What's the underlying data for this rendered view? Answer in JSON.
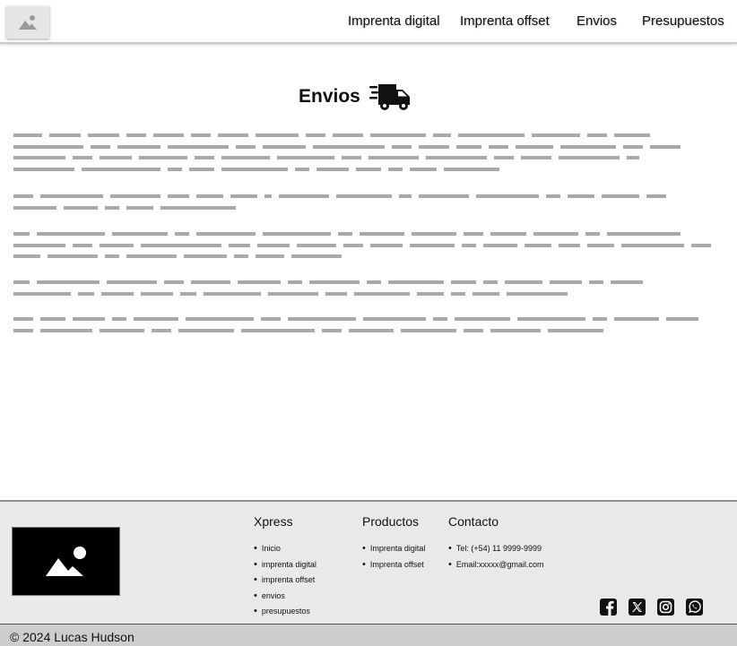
{
  "header": {
    "logo_icon": "image-placeholder-icon",
    "nav": [
      "Imprenta digital",
      "Imprenta offset",
      "Envios",
      "Presupuestos"
    ]
  },
  "main": {
    "title": "Envios",
    "title_icon": "shipping-truck-icon"
  },
  "footer": {
    "image_icon": "image-placeholder-icon",
    "columns": [
      {
        "title": "Xpress",
        "items": [
          "Inicio",
          "imprenta digital",
          "imprenta  offset",
          "envios",
          "presupuestos"
        ]
      },
      {
        "title": "Productos",
        "items": [
          "Imprenta digital",
          "Imprenta offset"
        ]
      },
      {
        "title": "Contacto",
        "items": [
          "Tel: (+54) 11 9999-9999",
          "Email:xxxxx@gmail.com"
        ]
      }
    ],
    "social_icons": [
      "facebook-icon",
      "x-twitter-icon",
      "instagram-icon",
      "whatsapp-icon"
    ],
    "copyright": "© 2024 Lucas Hudson"
  },
  "colors": {
    "header_bg": "#ffffff",
    "footer_bg": "#e9e9e9",
    "copyright_bg": "#cdcdcd",
    "placeholder_text": "#a9a9a9"
  }
}
